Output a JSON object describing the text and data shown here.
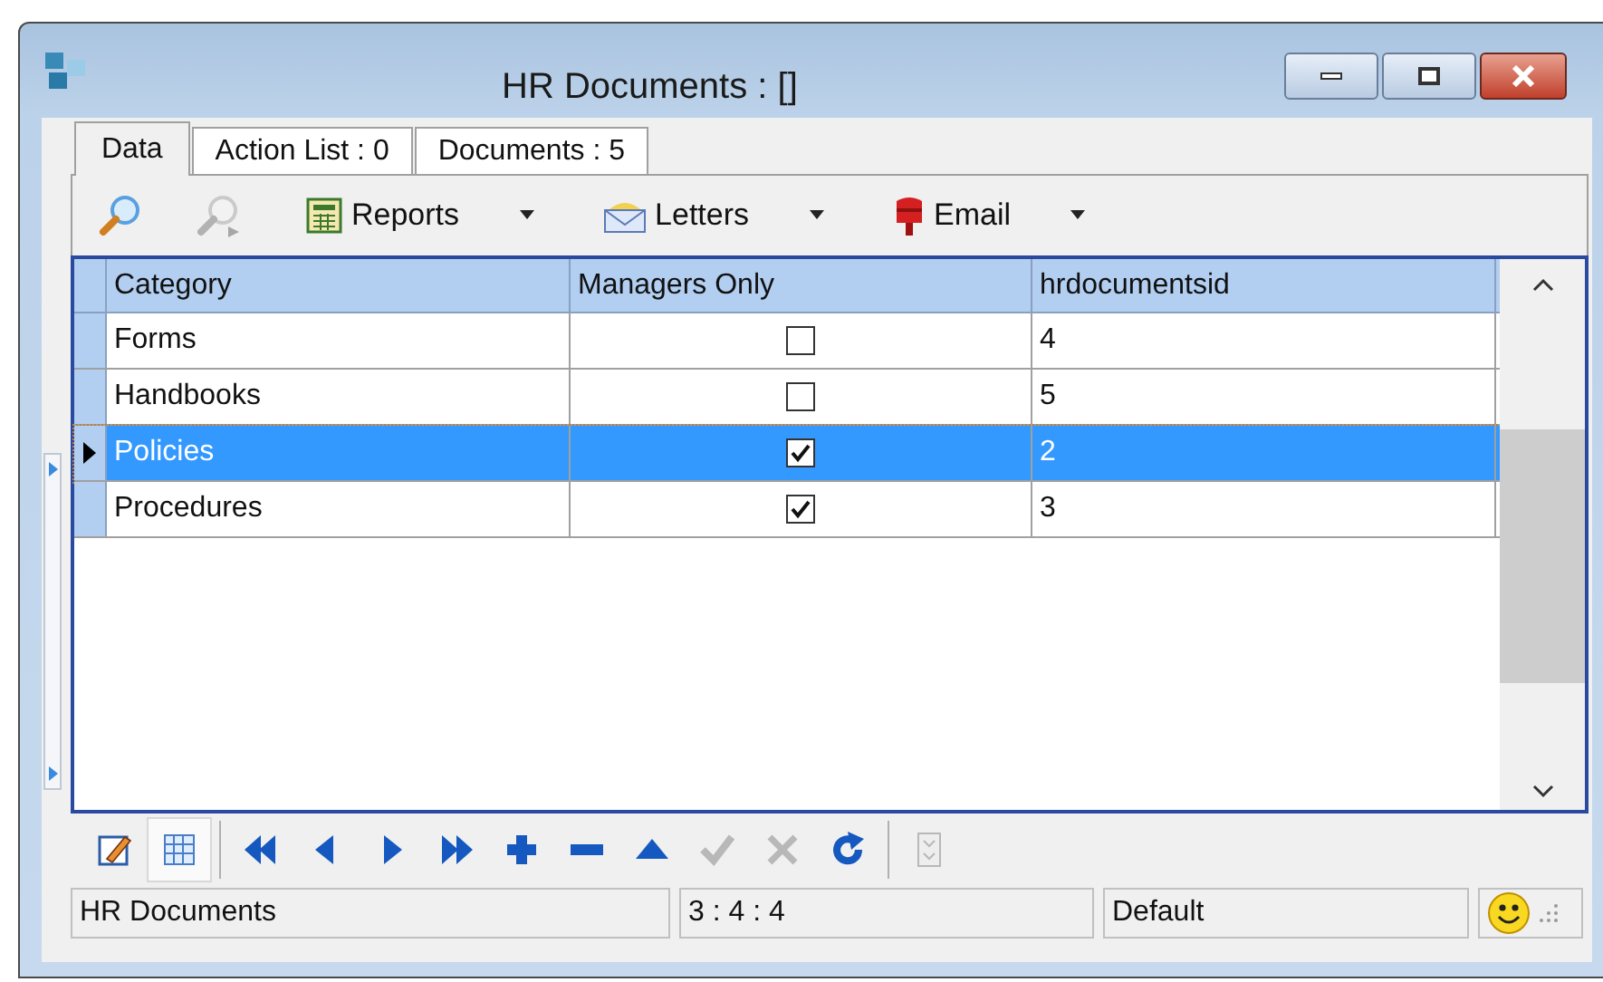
{
  "window": {
    "title": "HR Documents : []"
  },
  "tabs": [
    {
      "label": "Data",
      "selected": true
    },
    {
      "label": "Action List : 0",
      "selected": false
    },
    {
      "label": "Documents : 5",
      "selected": false
    }
  ],
  "toolbar": {
    "tools": [
      {
        "kind": "search",
        "disabled": false
      },
      {
        "kind": "filter",
        "disabled": true
      }
    ],
    "menus": [
      {
        "kind": "reports",
        "label": "Reports"
      },
      {
        "kind": "letters",
        "label": "Letters"
      },
      {
        "kind": "email",
        "label": "Email"
      }
    ]
  },
  "table": {
    "columns": [
      "Category",
      "Managers Only",
      "hrdocumentsid"
    ],
    "rows": [
      {
        "category": "Forms",
        "managers_only": false,
        "hrdocumentsid": "4",
        "selected": false
      },
      {
        "category": "Handbooks",
        "managers_only": false,
        "hrdocumentsid": "5",
        "selected": false
      },
      {
        "category": "Policies",
        "managers_only": true,
        "hrdocumentsid": "2",
        "selected": true
      },
      {
        "category": "Procedures",
        "managers_only": true,
        "hrdocumentsid": "3",
        "selected": false
      }
    ]
  },
  "navigator": [
    {
      "kind": "edit",
      "selected": false,
      "disabled": false
    },
    {
      "kind": "grid",
      "selected": true,
      "disabled": false
    },
    {
      "kind": "first",
      "selected": false,
      "disabled": false
    },
    {
      "kind": "prior",
      "selected": false,
      "disabled": false
    },
    {
      "kind": "next",
      "selected": false,
      "disabled": false
    },
    {
      "kind": "last",
      "selected": false,
      "disabled": false
    },
    {
      "kind": "insert",
      "selected": false,
      "disabled": false
    },
    {
      "kind": "delete",
      "selected": false,
      "disabled": false
    },
    {
      "kind": "edit-row",
      "selected": false,
      "disabled": false
    },
    {
      "kind": "post",
      "selected": false,
      "disabled": true
    },
    {
      "kind": "cancel",
      "selected": false,
      "disabled": true
    },
    {
      "kind": "refresh",
      "selected": false,
      "disabled": false
    },
    {
      "kind": "expand",
      "selected": false,
      "disabled": true
    }
  ],
  "status_bar": [
    "HR Documents",
    "3 : 4 : 4",
    "Default"
  ]
}
